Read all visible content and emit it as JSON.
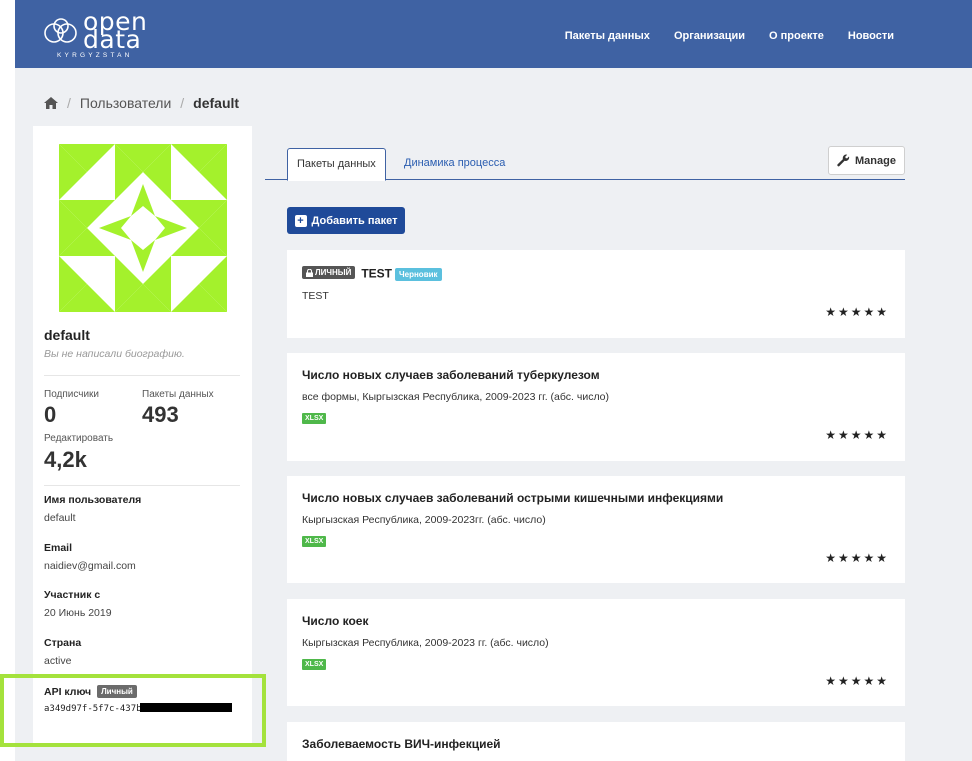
{
  "brand": {
    "line1": "open",
    "line2": "data",
    "sub": "KYRGYZSTAN"
  },
  "nav": [
    "Пакеты данных",
    "Организации",
    "О проекте",
    "Новости"
  ],
  "breadcrumb": {
    "item1": "Пользователи",
    "current": "default"
  },
  "profile": {
    "name": "default",
    "bio": "Вы не написали биографию.",
    "stats": {
      "followers_label": "Подписчики",
      "followers": "0",
      "datasets_label": "Пакеты данных",
      "datasets": "493",
      "edits_label": "Редактировать",
      "edits": "4,2k"
    },
    "username_label": "Имя пользователя",
    "username": "default",
    "email_label": "Email",
    "email": "naidiev@gmail.com",
    "member_label": "Участник с",
    "member_since": "20 Июнь 2019",
    "state_label": "Страна",
    "state": "active",
    "api_label": "API ключ",
    "api_badge": "Личный",
    "api_key": "a349d97f-5f7c-437b"
  },
  "tabs": {
    "datasets": "Пакеты данных",
    "activity": "Динамика процесса"
  },
  "manage_label": "Manage",
  "add_dataset_label": "Добавить пакет",
  "datasets": [
    {
      "private_label": "ЛИЧНЫЙ",
      "title": "TEST",
      "draft_label": "Черновик",
      "desc": "TEST",
      "rating": "★★★★★"
    },
    {
      "title": "Число новых случаев заболеваний туберкулезом",
      "desc": "все формы, Кыргызская Республика, 2009-2023 гг. (абс. число)",
      "format": "XLSX",
      "rating": "★★★★★"
    },
    {
      "title": "Число новых случаев заболеваний острыми кишечными инфекциями",
      "desc": "Кыргызская Республика, 2009-2023гг. (абс. число)",
      "format": "XLSX",
      "rating": "★★★★★"
    },
    {
      "title": "Число коек",
      "desc": "Кыргызская Республика, 2009-2023 гг. (абс. число)",
      "format": "XLSX",
      "rating": "★★★★★"
    },
    {
      "title": "Заболеваемость ВИЧ-инфекцией"
    }
  ],
  "colors": {
    "navbar": "#3f62a3",
    "primary_button": "#1f4a99",
    "highlight": "#a4e23c",
    "avatar": "#a4f12c",
    "format_badge": "#4fb84a",
    "draft_badge": "#5bc0de"
  }
}
